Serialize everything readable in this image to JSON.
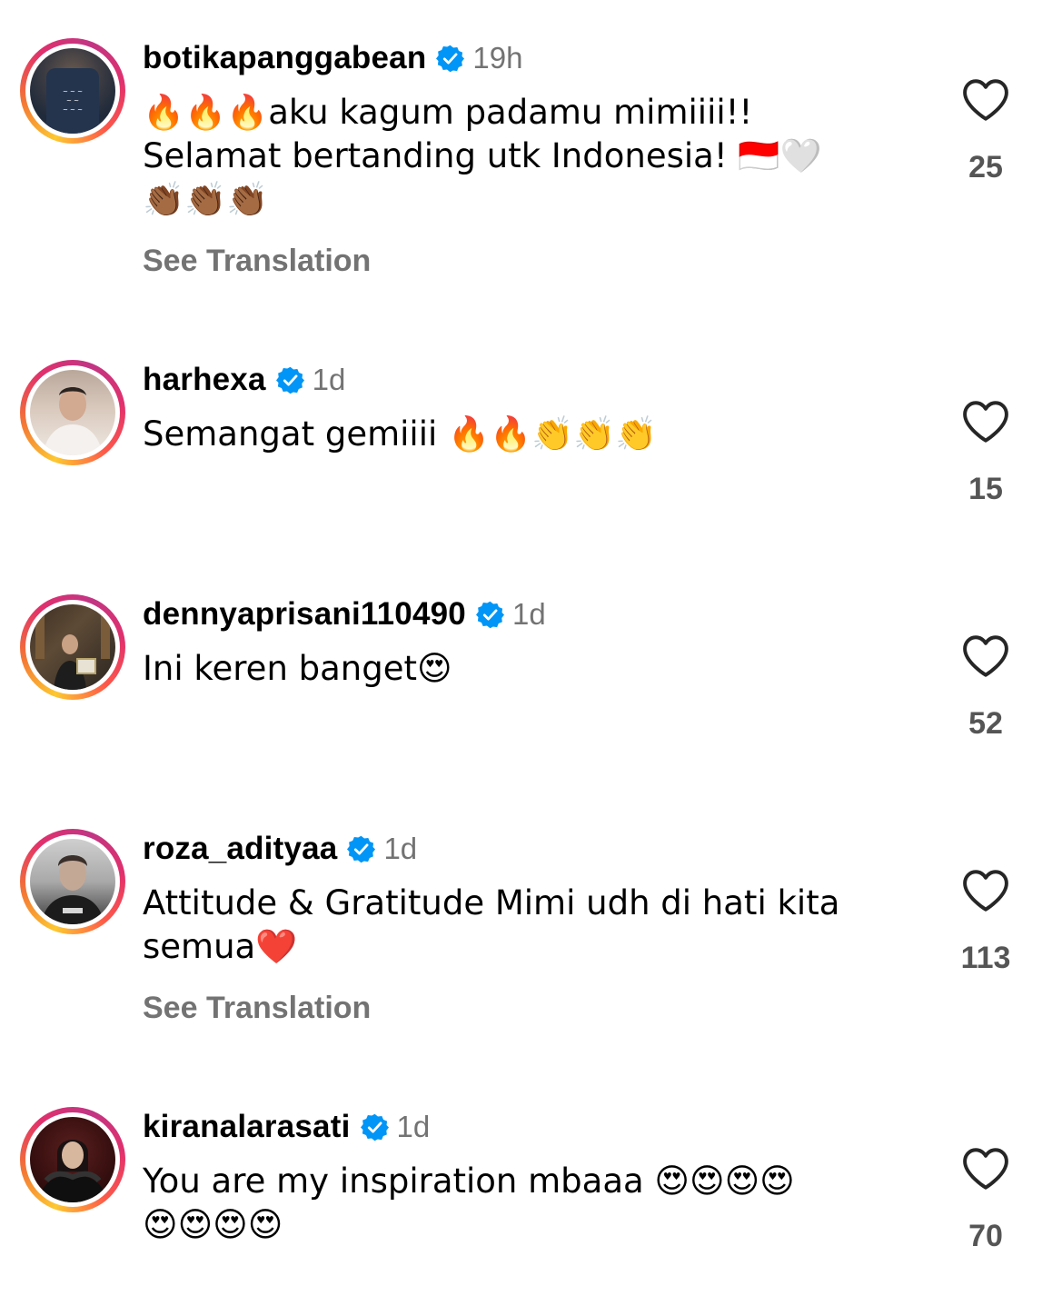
{
  "comments": [
    {
      "username": "botikapanggabean",
      "verified": true,
      "time": "19h",
      "text_lines": [
        "🔥🔥🔥aku kagum padamu mimiiii!!",
        "Selamat bertanding utk Indonesia! 🇮🇩🤍",
        "👏🏾👏🏾👏🏾"
      ],
      "see_translation": "See Translation",
      "likes": "25"
    },
    {
      "username": "harhexa",
      "verified": true,
      "time": "1d",
      "text_lines": [
        "Semangat gemiiii 🔥🔥👏👏👏"
      ],
      "likes": "15"
    },
    {
      "username": "dennyaprisani110490",
      "verified": true,
      "time": "1d",
      "text_lines": [
        "Ini keren banget😍"
      ],
      "likes": "52"
    },
    {
      "username": "roza_adityaa",
      "verified": true,
      "time": "1d",
      "text_lines": [
        "Attitude & Gratitude Mimi udh di hati kita",
        "semua❤️"
      ],
      "see_translation": "See Translation",
      "likes": "113"
    },
    {
      "username": "kiranalarasati",
      "verified": true,
      "time": "1d",
      "text_lines": [
        "You are my inspiration mbaaa 😍😍😍😍",
        "😍😍😍😍"
      ],
      "likes": "70"
    }
  ],
  "colors": {
    "verified_blue": "#0095f6",
    "secondary_text": "#737373",
    "ring_gradient": [
      "#fdc830",
      "#f37335",
      "#e1306c",
      "#c13584"
    ]
  },
  "icons": {
    "like": "heart-outline-icon",
    "verified": "verified-badge-icon"
  }
}
